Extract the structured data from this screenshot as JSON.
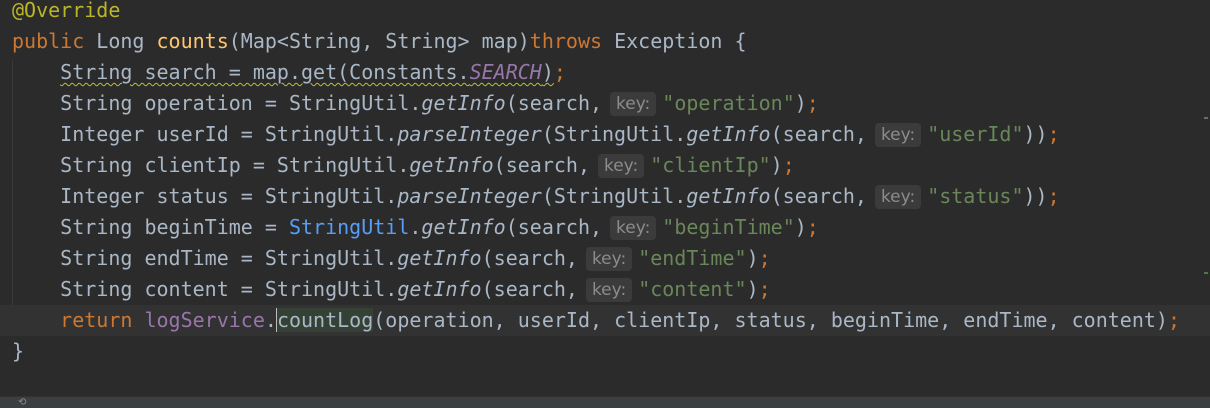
{
  "editor": {
    "language": "Java",
    "colors": {
      "background": "#2b2b2b",
      "caret_line": "#323232",
      "keyword": "#cc7832",
      "annotation": "#bbb529",
      "method_declaration": "#ffc66d",
      "string": "#6a8759",
      "constant": "#9876aa",
      "default_text": "#a9b7c6",
      "inlay_hint": "#8c8c8c",
      "highlighted_class": "#589df6"
    },
    "lines": [
      {
        "tokens": [
          {
            "t": "@Override",
            "k": "annotation"
          }
        ]
      },
      {
        "tokens": [
          {
            "t": "public",
            "k": "keyword"
          },
          {
            "t": " Long ",
            "k": "plain"
          },
          {
            "t": "counts",
            "k": "method-decl"
          },
          {
            "t": "(Map<String, String> map)",
            "k": "plain"
          },
          {
            "t": "throws",
            "k": "keyword"
          },
          {
            "t": " Exception {",
            "k": "plain"
          }
        ]
      },
      {
        "tokens": [
          {
            "t": "    ",
            "k": "plain"
          },
          {
            "t": "String search = map.get(Constants.",
            "k": "plain",
            "squiggle": true
          },
          {
            "t": "SEARCH",
            "k": "const",
            "squiggle": true
          },
          {
            "t": ")",
            "k": "plain",
            "squiggle": true
          },
          {
            "t": ";",
            "k": "keyword"
          }
        ]
      },
      {
        "tokens": [
          {
            "t": "    String operation = StringUtil.",
            "k": "plain"
          },
          {
            "t": "getInfo",
            "k": "static-call"
          },
          {
            "t": "(search,",
            "k": "plain"
          },
          {
            "hint": "key:"
          },
          {
            "t": "\"operation\"",
            "k": "string"
          },
          {
            "t": ")",
            "k": "plain"
          },
          {
            "t": ";",
            "k": "keyword"
          }
        ]
      },
      {
        "tokens": [
          {
            "t": "    Integer userId = StringUtil.",
            "k": "plain"
          },
          {
            "t": "parseInteger",
            "k": "static-call"
          },
          {
            "t": "(StringUtil.",
            "k": "plain"
          },
          {
            "t": "getInfo",
            "k": "static-call"
          },
          {
            "t": "(search,",
            "k": "plain"
          },
          {
            "hint": "key:"
          },
          {
            "t": "\"userId\"",
            "k": "string"
          },
          {
            "t": "))",
            "k": "plain"
          },
          {
            "t": ";",
            "k": "keyword"
          }
        ]
      },
      {
        "tokens": [
          {
            "t": "    String clientIp = StringUtil.",
            "k": "plain"
          },
          {
            "t": "getInfo",
            "k": "static-call"
          },
          {
            "t": "(search,",
            "k": "plain"
          },
          {
            "hint": "key:"
          },
          {
            "t": "\"clientIp\"",
            "k": "string"
          },
          {
            "t": ")",
            "k": "plain"
          },
          {
            "t": ";",
            "k": "keyword"
          }
        ]
      },
      {
        "tokens": [
          {
            "t": "    Integer status = StringUtil.",
            "k": "plain"
          },
          {
            "t": "parseInteger",
            "k": "static-call"
          },
          {
            "t": "(StringUtil.",
            "k": "plain"
          },
          {
            "t": "getInfo",
            "k": "static-call"
          },
          {
            "t": "(search,",
            "k": "plain"
          },
          {
            "hint": "key:"
          },
          {
            "t": "\"status\"",
            "k": "string"
          },
          {
            "t": "))",
            "k": "plain"
          },
          {
            "t": ";",
            "k": "keyword"
          }
        ]
      },
      {
        "tokens": [
          {
            "t": "    String beginTime = ",
            "k": "plain"
          },
          {
            "t": "StringUtil",
            "k": "class-hl"
          },
          {
            "t": ".",
            "k": "plain"
          },
          {
            "t": "getInfo",
            "k": "static-call"
          },
          {
            "t": "(search,",
            "k": "plain"
          },
          {
            "hint": "key:"
          },
          {
            "t": "\"beginTime\"",
            "k": "string"
          },
          {
            "t": ")",
            "k": "plain"
          },
          {
            "t": ";",
            "k": "keyword"
          }
        ]
      },
      {
        "tokens": [
          {
            "t": "    String endTime = StringUtil.",
            "k": "plain"
          },
          {
            "t": "getInfo",
            "k": "static-call"
          },
          {
            "t": "(search,",
            "k": "plain"
          },
          {
            "hint": "key:"
          },
          {
            "t": "\"endTime\"",
            "k": "string"
          },
          {
            "t": ")",
            "k": "plain"
          },
          {
            "t": ";",
            "k": "keyword"
          }
        ]
      },
      {
        "tokens": [
          {
            "t": "    String content = StringUtil.",
            "k": "plain"
          },
          {
            "t": "getInfo",
            "k": "static-call"
          },
          {
            "t": "(search,",
            "k": "plain"
          },
          {
            "hint": "key:"
          },
          {
            "t": "\"content\"",
            "k": "string"
          },
          {
            "t": ")",
            "k": "plain"
          },
          {
            "t": ";",
            "k": "keyword"
          }
        ]
      },
      {
        "caret_line": true,
        "tokens": [
          {
            "t": "    ",
            "k": "plain"
          },
          {
            "t": "return",
            "k": "keyword"
          },
          {
            "t": " ",
            "k": "plain"
          },
          {
            "t": "logService",
            "k": "field-ref"
          },
          {
            "t": ".",
            "k": "plain"
          },
          {
            "caret": true
          },
          {
            "t": "countLog",
            "k": "plain",
            "method_hl": true
          },
          {
            "t": "(operation, userId, clientIp, status, beginTime, endTime, content)",
            "k": "plain"
          },
          {
            "t": ";",
            "k": "keyword"
          }
        ]
      },
      {
        "tokens": [
          {
            "t": "}",
            "k": "plain"
          }
        ]
      }
    ]
  }
}
